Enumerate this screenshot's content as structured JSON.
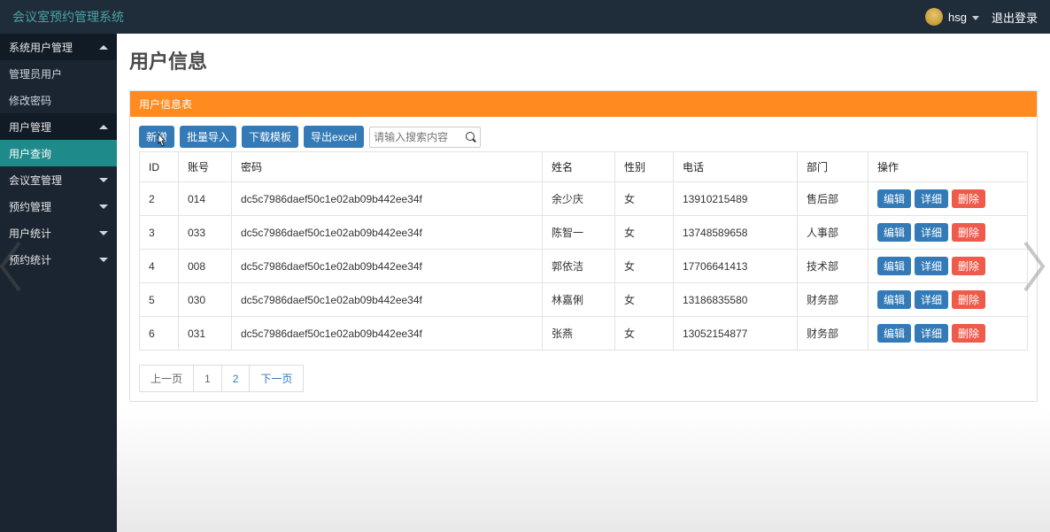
{
  "app_title": "会议室预约管理系统",
  "user_name": "hsg",
  "logout_label": "退出登录",
  "sidebar": {
    "sections": [
      {
        "label": "系统用户管理",
        "expanded": true
      },
      {
        "label": "管理员用户",
        "type": "sub"
      },
      {
        "label": "修改密码",
        "type": "sub"
      },
      {
        "label": "用户管理",
        "expanded": true
      },
      {
        "label": "用户查询",
        "type": "sub",
        "active": true
      },
      {
        "label": "会议室管理",
        "expanded": false
      },
      {
        "label": "预约管理",
        "expanded": false
      },
      {
        "label": "用户统计",
        "expanded": false
      },
      {
        "label": "预约统计",
        "expanded": false
      }
    ]
  },
  "page_title": "用户信息",
  "panel_title": "用户信息表",
  "toolbar": {
    "add_label": "新增",
    "batch_import_label": "批量导入",
    "download_template_label": "下载模板",
    "export_excel_label": "导出excel",
    "search_placeholder": "请输入搜索内容"
  },
  "columns": [
    "ID",
    "账号",
    "密码",
    "姓名",
    "性别",
    "电话",
    "部门",
    "操作"
  ],
  "rows": [
    {
      "id": "2",
      "account": "014",
      "pwd": "dc5c7986daef50c1e02ab09b442ee34f",
      "name": "余少庆",
      "gender": "女",
      "phone": "13910215489",
      "dept": "售后部"
    },
    {
      "id": "3",
      "account": "033",
      "pwd": "dc5c7986daef50c1e02ab09b442ee34f",
      "name": "陈智一",
      "gender": "女",
      "phone": "13748589658",
      "dept": "人事部"
    },
    {
      "id": "4",
      "account": "008",
      "pwd": "dc5c7986daef50c1e02ab09b442ee34f",
      "name": "郭依洁",
      "gender": "女",
      "phone": "17706641413",
      "dept": "技术部"
    },
    {
      "id": "5",
      "account": "030",
      "pwd": "dc5c7986daef50c1e02ab09b442ee34f",
      "name": "林嘉俐",
      "gender": "女",
      "phone": "13186835580",
      "dept": "财务部"
    },
    {
      "id": "6",
      "account": "031",
      "pwd": "dc5c7986daef50c1e02ab09b442ee34f",
      "name": "张燕",
      "gender": "女",
      "phone": "13052154877",
      "dept": "财务部"
    }
  ],
  "actions": {
    "edit": "编辑",
    "detail": "详细",
    "delete": "删除"
  },
  "pager": {
    "prev": "上一页",
    "pages": [
      "1",
      "2"
    ],
    "next": "下一页"
  }
}
